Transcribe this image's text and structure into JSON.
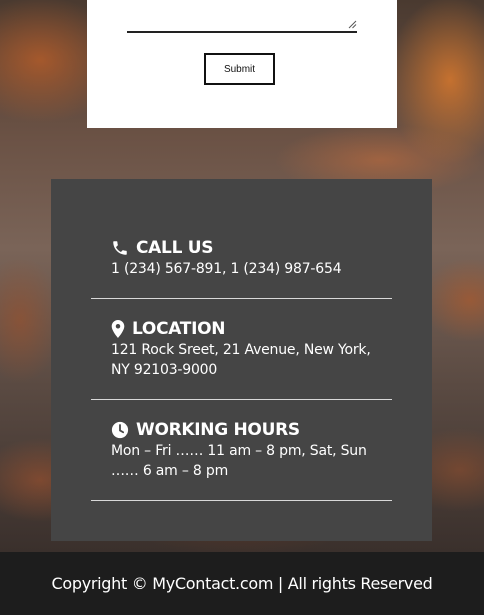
{
  "form": {
    "submit_label": "Submit"
  },
  "contact": {
    "call": {
      "icon": "phone-icon",
      "title": "CALL US",
      "text": "1 (234) 567-891, 1 (234) 987-654"
    },
    "location": {
      "icon": "map-pin-icon",
      "title": "LOCATION",
      "text": "121 Rock Sreet, 21 Avenue, New York, NY 92103-9000"
    },
    "hours": {
      "icon": "clock-icon",
      "title": "WORKING HOURS",
      "text": "Mon – Fri …… 11 am – 8 pm, Sat, Sun …… 6 am – 8 pm"
    }
  },
  "footer": {
    "copyright": "Copyright © MyContact.com | All rights Reserved"
  },
  "colors": {
    "card_bg": "#454545",
    "footer_bg": "#1d1d1d",
    "form_bg": "#ffffff"
  }
}
